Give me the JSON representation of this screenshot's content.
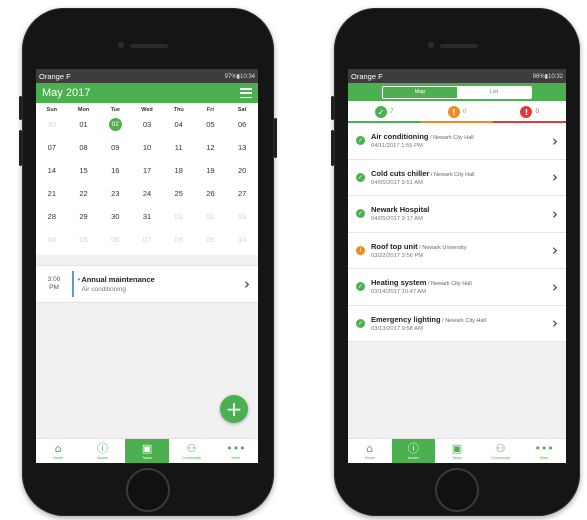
{
  "colors": {
    "accent": "#4caf50",
    "warning": "#ef8a21",
    "error": "#e53935",
    "event_bar": "#5b9bd5"
  },
  "calendar_screen": {
    "status_bar": {
      "carrier": "Orange F",
      "right": "97%▮10:34"
    },
    "header": {
      "month_title": "May 2017",
      "menu_icon": "hamburger-menu-icon"
    },
    "weekdays": [
      "Sun",
      "Mon",
      "Tue",
      "Wed",
      "Thu",
      "Fri",
      "Sat"
    ],
    "weeks": [
      [
        "30",
        "01",
        "02",
        "03",
        "04",
        "05",
        "06"
      ],
      [
        "07",
        "08",
        "09",
        "10",
        "11",
        "12",
        "13"
      ],
      [
        "14",
        "15",
        "16",
        "17",
        "18",
        "19",
        "20"
      ],
      [
        "21",
        "22",
        "23",
        "24",
        "25",
        "26",
        "27"
      ],
      [
        "28",
        "29",
        "30",
        "31",
        "01",
        "02",
        "03"
      ],
      [
        "04",
        "05",
        "06",
        "07",
        "08",
        "09",
        "10"
      ]
    ],
    "selected_day": "02",
    "event": {
      "time_hour": "3:00",
      "time_period": "PM",
      "title": "Annual maintenance",
      "subtitle": "Air conditioning"
    },
    "fab_label": "+",
    "nav": [
      {
        "label": "Home",
        "icon": "home-icon",
        "glyph": "⌂"
      },
      {
        "label": "Issues",
        "icon": "alert-circle-icon",
        "glyph": "ⓘ"
      },
      {
        "label": "Tasks",
        "icon": "calendar-icon",
        "glyph": "▣"
      },
      {
        "label": "Community",
        "icon": "community-icon",
        "glyph": "⚇"
      },
      {
        "label": "More",
        "icon": "more-dots-icon",
        "glyph": "•••"
      }
    ],
    "active_nav": 2
  },
  "list_screen": {
    "status_bar": {
      "carrier": "Orange F",
      "right": "96%▮10:32"
    },
    "toggle": {
      "map_label": "Map",
      "list_label": "List"
    },
    "summary": [
      {
        "count": "7",
        "type": "ok",
        "icon": "check-circle-icon",
        "glyph": "✓"
      },
      {
        "count": "0",
        "type": "warning",
        "icon": "warning-circle-icon",
        "glyph": "!"
      },
      {
        "count": "0",
        "type": "error",
        "icon": "error-circle-icon",
        "glyph": "!"
      }
    ],
    "tasks": [
      {
        "title": "Air conditioning",
        "location": "Newark City Hall",
        "date": "04/11/2017 1:55 PM",
        "status": "ok"
      },
      {
        "title": "Cold cuts chiller",
        "location": "Newark City Hall",
        "date": "04/05/2017 9:51 AM",
        "status": "ok"
      },
      {
        "title": "Newark Hospital",
        "location": "",
        "date": "04/05/2017 9:17 AM",
        "status": "ok"
      },
      {
        "title": "Roof top unit",
        "location": "Newark University",
        "date": "03/22/2017 3:56 PM",
        "status": "warning"
      },
      {
        "title": "Heating system",
        "location": "Newark City Hall",
        "date": "03/14/2017 10:47 AM",
        "status": "ok"
      },
      {
        "title": "Emergency lighting",
        "location": "Newark City Hall",
        "date": "03/13/2017 9:58 AM",
        "status": "ok"
      }
    ],
    "nav": [
      {
        "label": "Home",
        "icon": "home-icon",
        "glyph": "⌂"
      },
      {
        "label": "Issues",
        "icon": "alert-circle-icon",
        "glyph": "ⓘ"
      },
      {
        "label": "Tasks",
        "icon": "calendar-icon",
        "glyph": "▣"
      },
      {
        "label": "Community",
        "icon": "community-icon",
        "glyph": "⚇"
      },
      {
        "label": "More",
        "icon": "more-dots-icon",
        "glyph": "•••"
      }
    ],
    "active_nav": 1
  }
}
